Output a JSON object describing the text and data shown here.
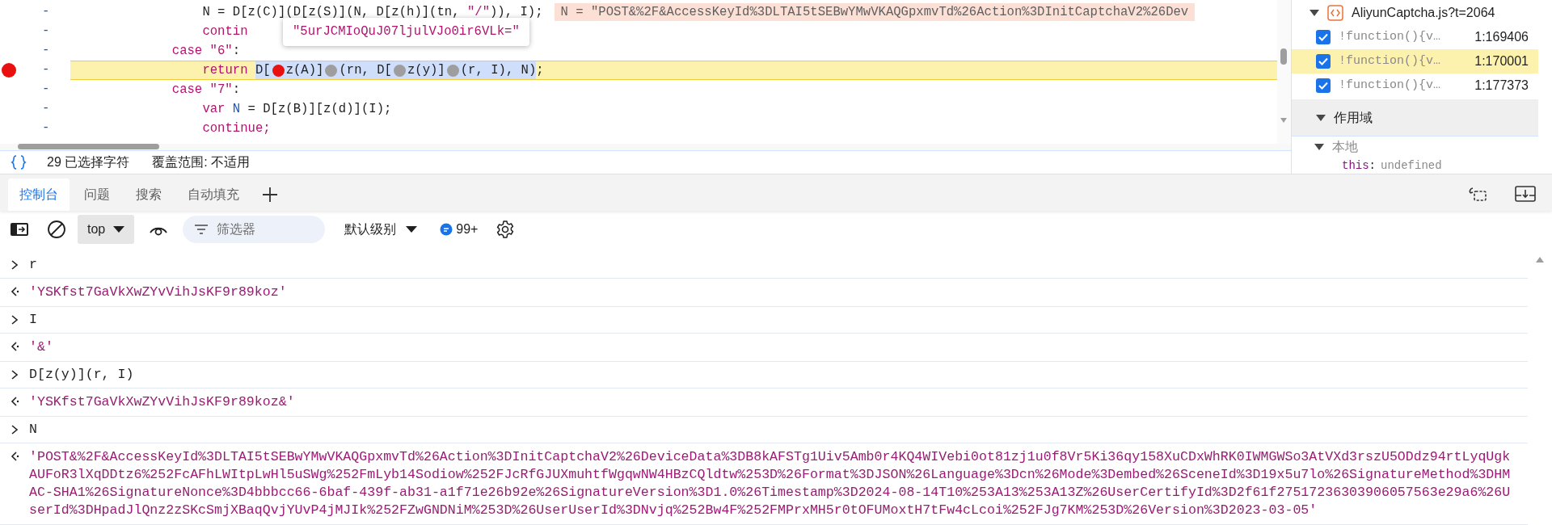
{
  "editor": {
    "lines": [
      {
        "children": [
          {
            "breakpoint": false,
            "current": false,
            "tokens": [
              {
                "kind": "plain",
                "text": "N = D[z(C)](D[z(S)](N, D[z(h)](tn, "
              },
              {
                "kind": "string",
                "text": "\"/\""
              },
              {
                "kind": "plain",
                "text": ")), I);"
              }
            ],
            "inline_value": "N = \"POST&%2F&AccessKeyId%3DLTAI5tSEBwYMwVKAQGpxmvTd%26Action%3DInitCaptchaV2%26Dev"
          },
          {
            "breakpoint": false,
            "current": false,
            "tokens": [
              {
                "kind": "keyword",
                "text": "contin"
              }
            ]
          }
        ]
      },
      {
        "breakpoint": false,
        "current": false,
        "tokens": [
          {
            "kind": "keyword",
            "text": "case "
          },
          {
            "kind": "string",
            "text": "\"6\""
          },
          {
            "kind": "plain",
            "text": ":"
          }
        ],
        "children": [
          {
            "breakpoint": true,
            "current": true,
            "tokens": [
              {
                "kind": "keyword",
                "text": "return "
              }
            ],
            "selection": [
              {
                "kind": "plain",
                "text": "D["
              },
              {
                "kind": "marker",
                "active": true
              },
              {
                "kind": "plain",
                "text": "z(A)]"
              },
              {
                "kind": "marker",
                "active": false
              },
              {
                "kind": "plain",
                "text": "(rn, D["
              },
              {
                "kind": "marker",
                "active": false
              },
              {
                "kind": "plain",
                "text": "z(y)]"
              },
              {
                "kind": "marker",
                "active": false
              },
              {
                "kind": "plain",
                "text": "(r, I), N)"
              }
            ],
            "after": [
              {
                "kind": "plain",
                "text": ";"
              }
            ]
          }
        ]
      },
      {
        "breakpoint": false,
        "current": false,
        "tokens": [
          {
            "kind": "keyword",
            "text": "case "
          },
          {
            "kind": "string",
            "text": "\"7\""
          },
          {
            "kind": "plain",
            "text": ":"
          }
        ],
        "children": [
          {
            "breakpoint": false,
            "current": false,
            "tokens": [
              {
                "kind": "keyword",
                "text": "var "
              },
              {
                "kind": "declared",
                "text": "N"
              },
              {
                "kind": "plain",
                "text": " = D[z(B)][z(d)](I);"
              }
            ]
          },
          {
            "breakpoint": false,
            "current": false,
            "tokens": [
              {
                "kind": "keyword",
                "text": "continue;"
              }
            ]
          }
        ]
      }
    ],
    "line_marker": "-",
    "tooltip": "\"5urJCMIoQuJ07ljulVJo0ir6VLk=\""
  },
  "status_bar": {
    "selection": "29 已选择字符",
    "coverage": "覆盖范围: 不适用"
  },
  "breakpoints": {
    "file": "AliyunCaptcha.js?t=2064",
    "expanded": true,
    "items": [
      {
        "checked": true,
        "code": "!function(){v…",
        "location": "1:169406",
        "selected": false
      },
      {
        "checked": true,
        "code": "!function(){v…",
        "location": "1:170001",
        "selected": true
      },
      {
        "checked": true,
        "code": "!function(){v…",
        "location": "1:177373",
        "selected": false
      }
    ]
  },
  "scope": {
    "title": "作用域",
    "expanded": true,
    "children": [
      {
        "label": "本地",
        "expanded": true,
        "children": [
          {
            "name": "this",
            "separator": ":",
            "value": "undefined"
          }
        ]
      }
    ]
  },
  "tabs": [
    {
      "label": "控制台",
      "selected": true
    },
    {
      "label": "问题",
      "selected": false
    },
    {
      "label": "搜索",
      "selected": false
    },
    {
      "label": "自动填充",
      "selected": false
    }
  ],
  "toolbar": {
    "context": "top",
    "filter_placeholder": "筛选器",
    "level": "默认级别",
    "messages": "99+"
  },
  "console": [
    {
      "kind": "input",
      "text": "r"
    },
    {
      "kind": "output",
      "text": "'YSKfst7GaVkXwZYvVihJsKF9r89koz'"
    },
    {
      "kind": "input",
      "text": "I"
    },
    {
      "kind": "output",
      "text": "'&'"
    },
    {
      "kind": "input",
      "text": "D[z(y)](r, I)"
    },
    {
      "kind": "output",
      "text": "'YSKfst7GaVkXwZYvVihJsKF9r89koz&'"
    },
    {
      "kind": "input",
      "text": "N"
    },
    {
      "kind": "output",
      "text": "'POST&%2F&AccessKeyId%3DLTAI5tSEBwYMwVKAQGpxmvTd%26Action%3DInitCaptchaV2%26DeviceData%3DB8kAFSTg1Uiv5Amb0r4KQ4WIVebi0ot81zj1u0f8Vr5Ki36qy158XuCDxWhRK0IWMGWSo3AtVXd3rszU5ODdz94rtLyqUgkAUFoR3lXqDDtz6%252FcAFhLWItpLwHl5uSWg%252FmLyb14Sodiow%252FJcRfGJUXmuhtfWgqwNW4HBzCQldtw%253D%26Format%3DJSON%26Language%3Dcn%26Mode%3Dembed%26SceneId%3D19x5u7lo%26SignatureMethod%3DHMAC-SHA1%26SignatureNonce%3D4bbbcc66-6baf-439f-ab31-a1f71e26b92e%26SignatureVersion%3D1.0%26Timestamp%3D2024-08-14T10%253A13%253A13Z%26UserCertifyId%3D2f61f27517236303906057563e29a6%26UserId%3DHpadJlQnz2zSKcSmjXBaqQvjYUvP4jMJIk%252FZwGNDNiM%253D%26UserUserId%3DNvjq%252Bw4F%252FMPrxMH5r0tOFUMoxtH7tFw4cLcoi%252FJg7KM%253D%26Version%3D2023-03-05'"
    }
  ]
}
